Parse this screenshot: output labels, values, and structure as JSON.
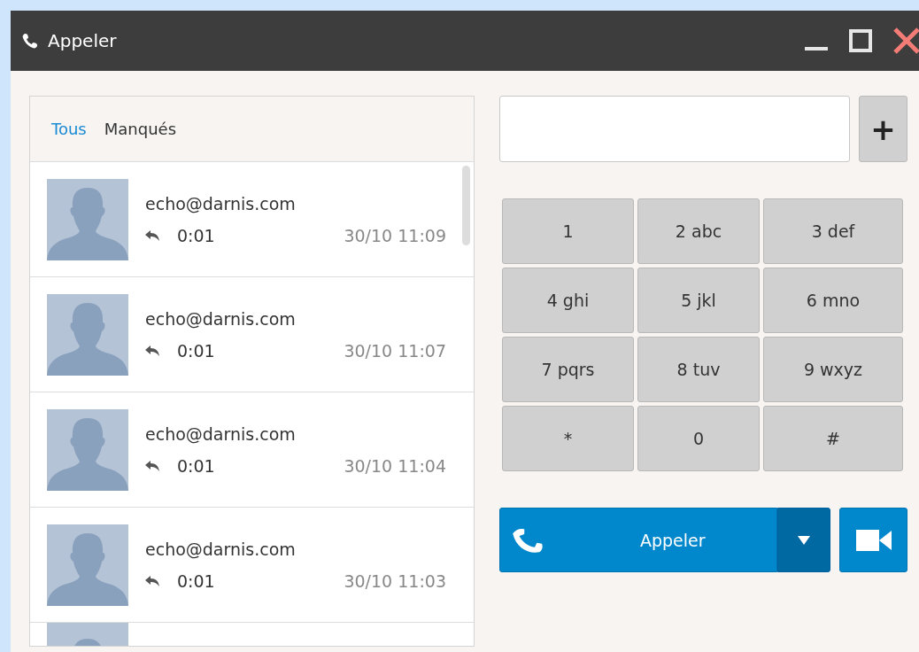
{
  "window": {
    "title": "Appeler"
  },
  "tabs": [
    {
      "label": "Tous",
      "selected": true
    },
    {
      "label": "Manqués",
      "selected": false
    }
  ],
  "calls": [
    {
      "contact": "echo@darnis.com",
      "duration": "0:01",
      "time": "30/10 11:09"
    },
    {
      "contact": "echo@darnis.com",
      "duration": "0:01",
      "time": "30/10 11:07"
    },
    {
      "contact": "echo@darnis.com",
      "duration": "0:01",
      "time": "30/10 11:04"
    },
    {
      "contact": "echo@darnis.com",
      "duration": "0:01",
      "time": "30/10 11:03"
    }
  ],
  "add_button": {
    "label": "+"
  },
  "keypad": [
    "1",
    "2 abc",
    "3 def",
    "4 ghi",
    "5 jkl",
    "6 mno",
    "7 pqrs",
    "8 tuv",
    "9 wxyz",
    "*",
    "0",
    "#"
  ],
  "call_button": {
    "label": "Appeler"
  }
}
